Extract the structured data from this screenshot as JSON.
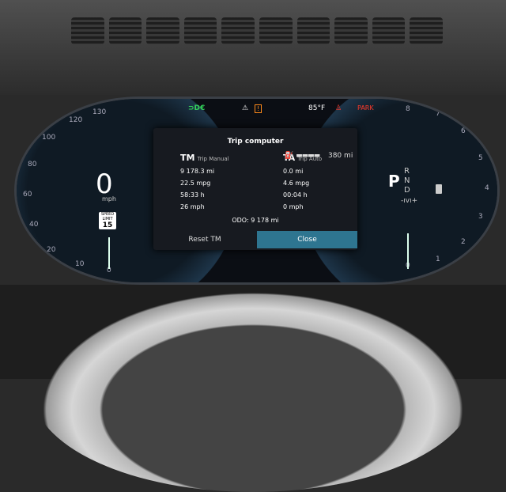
{
  "indicators": {
    "lights_icon": "headlight-icon",
    "warning_icon": "warning-triangle-icon",
    "temperature": "85°F",
    "park": "PARK"
  },
  "speedometer": {
    "ticks": [
      "130",
      "120",
      "100",
      "80",
      "60",
      "40",
      "20",
      "10",
      "0"
    ],
    "speed": "0",
    "unit": "mph",
    "limit_title": "SPEED LIMIT",
    "limit_value": "15"
  },
  "tachometer": {
    "ticks": [
      "8",
      "7",
      "6",
      "5",
      "4",
      "3",
      "2",
      "1",
      "0"
    ],
    "gear": "P",
    "prnd": [
      "R",
      "N",
      "D"
    ],
    "mode": "-ıvı+"
  },
  "trip_computer": {
    "title": "Trip computer",
    "manual": {
      "code": "TM",
      "name": "Trip Manual",
      "distance": "9 178.3",
      "distance_unit": "mi",
      "economy": "22.5",
      "economy_unit": "mpg",
      "time": "58:33",
      "time_unit": "h",
      "speed": "26",
      "speed_unit": "mph"
    },
    "auto": {
      "code": "TA",
      "name": "Trip Auto",
      "distance": "0.0",
      "distance_unit": "mi",
      "economy": "4.6",
      "economy_unit": "mpg",
      "time": "00:04",
      "time_unit": "h",
      "speed": "0",
      "speed_unit": "mph"
    },
    "odo_label": "ODO:",
    "odo_value": "9 178",
    "odo_unit": "mi",
    "reset_label": "Reset TM",
    "close_label": "Close"
  },
  "range": "380",
  "range_unit": "mi"
}
